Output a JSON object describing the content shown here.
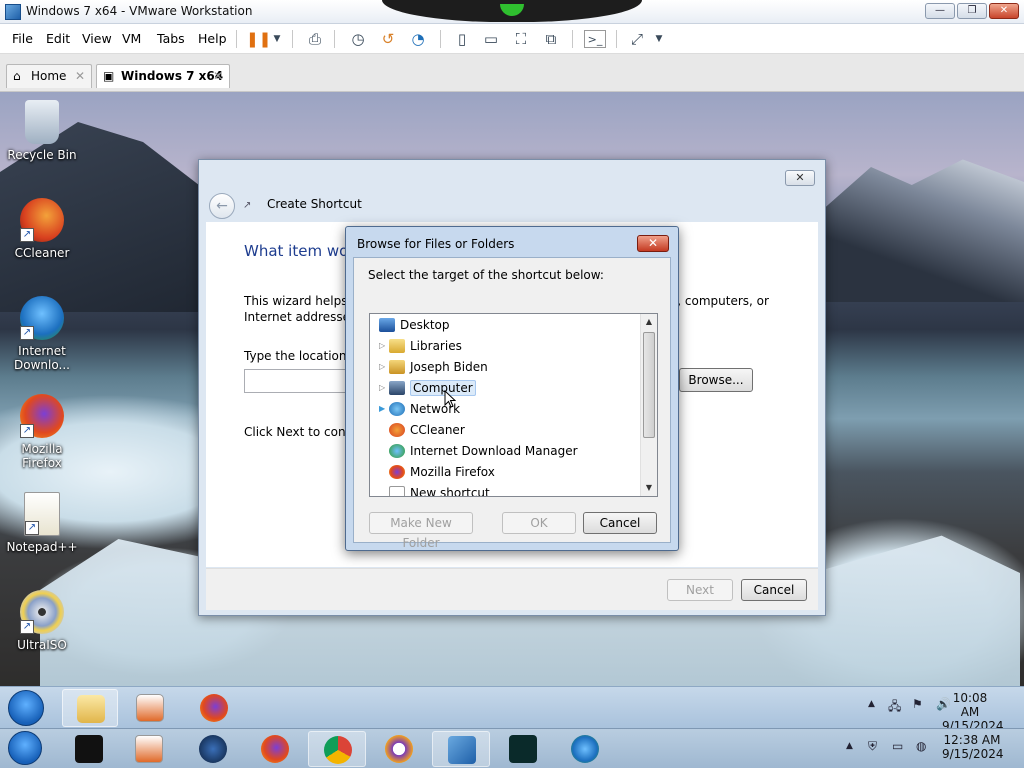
{
  "vmware": {
    "window_title": "Windows 7 x64 - VMware Workstation",
    "menu": [
      "File",
      "Edit",
      "View",
      "VM",
      "Tabs",
      "Help"
    ],
    "tabs": [
      {
        "label": "Home",
        "icon": "home-icon"
      },
      {
        "label": "Windows 7 x64",
        "icon": "vm-icon"
      }
    ],
    "tab_close_glyph": "✕"
  },
  "desktop_icons": [
    {
      "label": "Recycle Bin",
      "icon": "recycle-bin-icon"
    },
    {
      "label": "CCleaner",
      "icon": "ccleaner-icon"
    },
    {
      "label": "Internet Downlo...",
      "icon": "idm-icon"
    },
    {
      "label": "Mozilla Firefox",
      "icon": "firefox-icon"
    },
    {
      "label": "Notepad++",
      "icon": "notepad-plus-plus-icon"
    },
    {
      "label": "UltraISO",
      "icon": "ultraiso-icon"
    }
  ],
  "wizard": {
    "title": "Create Shortcut",
    "heading": "What item wou",
    "description": "This wizard helps y",
    "description_line2": "Internet addresses.",
    "description_right": "s, computers, or",
    "location_label": "Type the location o",
    "location_value": "",
    "browse_label": "Browse...",
    "next_hint": "Click Next to contin",
    "next_button": "Next",
    "cancel_button": "Cancel",
    "close_glyph": "✕"
  },
  "browse_dialog": {
    "title": "Browse for Files or Folders",
    "prompt": "Select the target of the shortcut below:",
    "items": [
      {
        "label": "Desktop",
        "icon": "desktop-icon",
        "indent": 0,
        "expandable": false
      },
      {
        "label": "Libraries",
        "icon": "libraries-icon",
        "indent": 1,
        "expandable": true
      },
      {
        "label": "Joseph Biden",
        "icon": "user-folder-icon",
        "indent": 1,
        "expandable": true
      },
      {
        "label": "Computer",
        "icon": "computer-icon",
        "indent": 1,
        "expandable": true,
        "selected": true
      },
      {
        "label": "Network",
        "icon": "network-icon",
        "indent": 1,
        "expandable": true
      },
      {
        "label": "CCleaner",
        "icon": "ccleaner-shortcut-icon",
        "indent": 1,
        "expandable": false
      },
      {
        "label": "Internet Download Manager",
        "icon": "idm-shortcut-icon",
        "indent": 1,
        "expandable": false
      },
      {
        "label": "Mozilla Firefox",
        "icon": "firefox-shortcut-icon",
        "indent": 1,
        "expandable": false
      },
      {
        "label": "New shortcut",
        "icon": "shortcut-icon",
        "indent": 1,
        "expandable": false
      }
    ],
    "make_new_folder": "Make New Folder",
    "ok": "OK",
    "cancel": "Cancel",
    "close_glyph": "✕"
  },
  "guest_taskbar": {
    "time": "10:08 AM",
    "date": "9/15/2024"
  },
  "host_taskbar": {
    "time": "12:38 AM",
    "date": "9/15/2024"
  },
  "colors": {
    "wizard_heading": "#1e3d8f",
    "selection_bg": "#dbeaf9",
    "close_red": "#c43a22",
    "vm_accent": "#e07010"
  }
}
